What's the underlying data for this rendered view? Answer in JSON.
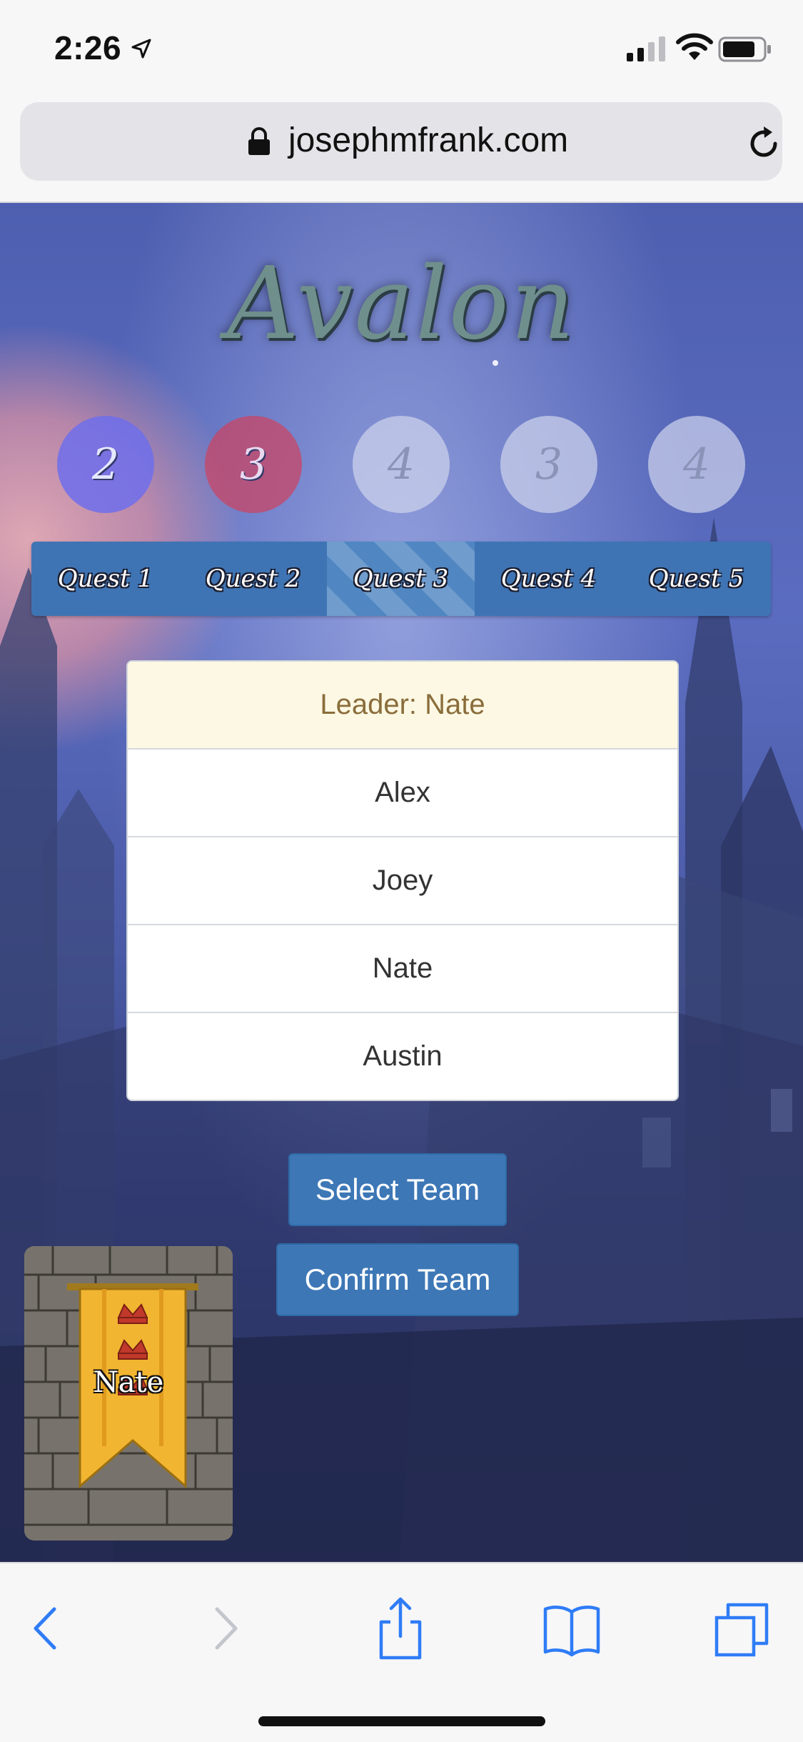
{
  "status_bar": {
    "time": "2:26"
  },
  "browser": {
    "url": "josephmfrank.com"
  },
  "game": {
    "logo": "Avalon",
    "quest_sizes": [
      "2",
      "3",
      "4",
      "3",
      "4"
    ],
    "quest_tabs": [
      "Quest 1",
      "Quest 2",
      "Quest 3",
      "Quest 4",
      "Quest 5"
    ],
    "active_quest_index": 2,
    "players": {
      "leader_label": "Leader: Nate",
      "items": [
        "Alex",
        "Joey",
        "Nate",
        "Austin"
      ]
    },
    "buttons": {
      "select_team": "Select Team",
      "confirm_team": "Confirm Team"
    },
    "leader_card_name": "Nate"
  },
  "colors": {
    "quest_done": "#6e6eeb",
    "quest_failed": "#c84664",
    "quest_bar": "#3f74b4",
    "button": "#3d77b6",
    "leader_row_bg": "#fcf8e3"
  }
}
